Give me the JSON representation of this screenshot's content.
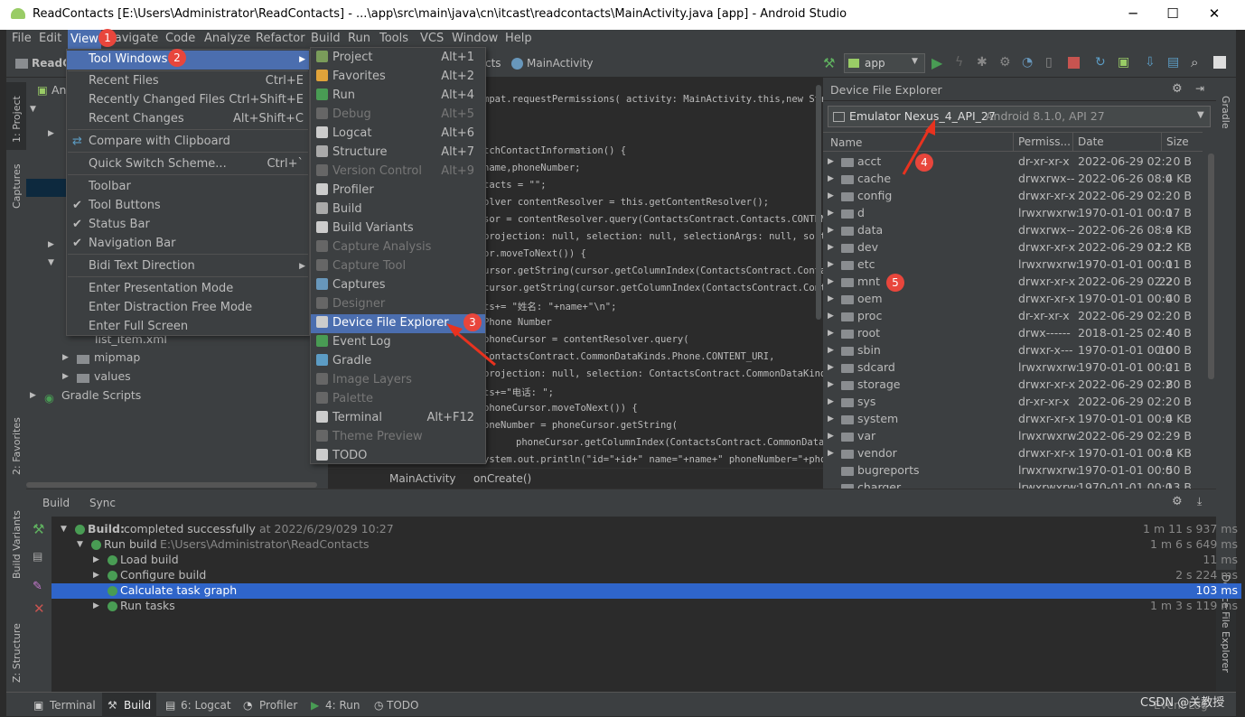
{
  "window": {
    "title": "ReadContacts [E:\\Users\\Administrator\\ReadContacts] - ...\\app\\src\\main\\java\\cn\\itcast\\readcontacts\\MainActivity.java [app] - Android Studio",
    "min": "─",
    "max": "☐",
    "close": "✕"
  },
  "menubar": [
    "File",
    "Edit",
    "View",
    "Navigate",
    "Code",
    "Analyze",
    "Refactor",
    "Build",
    "Run",
    "Tools",
    "VCS",
    "Window",
    "Help"
  ],
  "toolbar": {
    "project": "ReadC",
    "tab1": "cts",
    "tab2": "MainActivity",
    "config": "app"
  },
  "view_menu": [
    {
      "label": "Tool Windows",
      "shortcut": "",
      "arrow": "▶"
    },
    {
      "label": "Recent Files",
      "shortcut": "Ctrl+E"
    },
    {
      "label": "Recently Changed Files",
      "shortcut": "Ctrl+Shift+E"
    },
    {
      "label": "Recent Changes",
      "shortcut": "Alt+Shift+C"
    },
    {
      "label": "Compare with Clipboard",
      "shortcut": ""
    },
    {
      "label": "Quick Switch Scheme...",
      "shortcut": "Ctrl+`"
    },
    {
      "label": "Toolbar",
      "shortcut": ""
    },
    {
      "label": "Tool Buttons",
      "shortcut": "",
      "check": "✔"
    },
    {
      "label": "Status Bar",
      "shortcut": "",
      "check": "✔"
    },
    {
      "label": "Navigation Bar",
      "shortcut": "",
      "check": "✔"
    },
    {
      "label": "Bidi Text Direction",
      "shortcut": "",
      "arrow": "▶"
    },
    {
      "label": "Enter Presentation Mode",
      "shortcut": ""
    },
    {
      "label": "Enter Distraction Free Mode",
      "shortcut": ""
    },
    {
      "label": "Enter Full Screen",
      "shortcut": ""
    }
  ],
  "tool_windows": [
    {
      "label": "Project",
      "shortcut": "Alt+1",
      "color": "#7a9c5a"
    },
    {
      "label": "Favorites",
      "shortcut": "Alt+2",
      "color": "#e0a33a"
    },
    {
      "label": "Run",
      "shortcut": "Alt+4",
      "color": "#499c54"
    },
    {
      "label": "Debug",
      "shortcut": "Alt+5",
      "color": "#666"
    },
    {
      "label": "Logcat",
      "shortcut": "Alt+6",
      "color": "#ccc"
    },
    {
      "label": "Structure",
      "shortcut": "Alt+7",
      "color": "#aaa"
    },
    {
      "label": "Version Control",
      "shortcut": "Alt+9",
      "color": "#666"
    },
    {
      "label": "Profiler",
      "shortcut": "",
      "color": "#ccc"
    },
    {
      "label": "Build",
      "shortcut": "",
      "color": "#aaa"
    },
    {
      "label": "Build Variants",
      "shortcut": "",
      "color": "#ccc"
    },
    {
      "label": "Capture Analysis",
      "shortcut": "",
      "color": "#666"
    },
    {
      "label": "Capture Tool",
      "shortcut": "",
      "color": "#666"
    },
    {
      "label": "Captures",
      "shortcut": "",
      "color": "#6897bb"
    },
    {
      "label": "Designer",
      "shortcut": "",
      "color": "#666"
    },
    {
      "label": "Device File Explorer",
      "shortcut": "",
      "color": "#ccc"
    },
    {
      "label": "Event Log",
      "shortcut": "",
      "color": "#499c54"
    },
    {
      "label": "Gradle",
      "shortcut": "",
      "color": "#5c9cc4"
    },
    {
      "label": "Image Layers",
      "shortcut": "",
      "color": "#666"
    },
    {
      "label": "Palette",
      "shortcut": "",
      "color": "#666"
    },
    {
      "label": "Terminal",
      "shortcut": "Alt+F12",
      "color": "#ccc"
    },
    {
      "label": "Theme Preview",
      "shortcut": "",
      "color": "#666"
    },
    {
      "label": "TODO",
      "shortcut": "",
      "color": "#ccc"
    }
  ],
  "project_tree": [
    "An",
    "mipmap",
    "values",
    "Gradle Scripts",
    "list_item.xml"
  ],
  "editor_lines": [
    "mpat.requestPermissions( activity: MainActivity.this,new String",
    "tchContactInformation() {",
    "name,phoneNumber;",
    "tacts = \"\";",
    "olver contentResolver = this.getContentResolver();",
    "sor = contentResolver.query(ContactsContract.Contacts.CONTENT",
    "projection: null,  selection: null,  selectionArgs: null,  sortOrd",
    "or.moveToNext()) {",
    "ursor.getString(cursor.getColumnIndex(ContactsContract.Contac",
    " cursor.getString(cursor.getColumnIndex(ContactsContract.Cont",
    "ts+= \"姓名: \"+name+\"\\n\";",
    " Phone Number",
    " phoneCursor = contentResolver.query(",
    "ContactsContract.CommonDataKinds.Phone.CONTENT_URI,",
    " projection: null,  selection: ContactsContract.CommonDataKinds",
    "ts+=\"电话: \";",
    "phoneCursor.moveToNext()) {",
    "oneNumber = phoneCursor.getString(",
    "         phoneCursor.getColumnIndex(ContactsContract.CommonDataKin",
    "ystem.out.println(\"id=\"+id+\" name=\"+name+\" phoneNumber=\"+phoneNu"
  ],
  "breadcrumb": [
    "MainActivity",
    "onCreate()"
  ],
  "dfe": {
    "title": "Device File Explorer",
    "device": "Emulator Nexus_4_API_27",
    "device_detail": "Android 8.1.0, API 27",
    "columns": [
      "Name",
      "Permiss...",
      "Date",
      "Size"
    ],
    "rows": [
      [
        "acct",
        "dr-xr-xr-x",
        "2022-06-29 02:2",
        "0 B"
      ],
      [
        "cache",
        "drwxrwx--",
        "2022-06-26 08:0",
        "4 KB"
      ],
      [
        "config",
        "drwxr-xr-x",
        "2022-06-29 02:2",
        "0 B"
      ],
      [
        "d",
        "lrwxrwxrw:",
        "1970-01-01 00:0",
        "17 B"
      ],
      [
        "data",
        "drwxrwx--",
        "2022-06-26 08:0",
        "4 KB"
      ],
      [
        "dev",
        "drwxr-xr-x",
        "2022-06-29 02:2",
        "1.2 KB"
      ],
      [
        "etc",
        "lrwxrwxrw:",
        "1970-01-01 00:0",
        "11 B"
      ],
      [
        "mnt",
        "drwxr-xr-x",
        "2022-06-29 02:2",
        "220 B"
      ],
      [
        "oem",
        "drwxr-xr-x",
        "1970-01-01 00:0",
        "40 B"
      ],
      [
        "proc",
        "dr-xr-xr-x",
        "2022-06-29 02:2",
        "0 B"
      ],
      [
        "root",
        "drwx------",
        "2018-01-25 02:4",
        "40 B"
      ],
      [
        "sbin",
        "drwxr-x---",
        "1970-01-01 00:0",
        "100 B"
      ],
      [
        "sdcard",
        "lrwxrwxrw:",
        "1970-01-01 00:0",
        "21 B"
      ],
      [
        "storage",
        "drwxr-xr-x",
        "2022-06-29 02:2",
        "80 B"
      ],
      [
        "sys",
        "dr-xr-xr-x",
        "2022-06-29 02:2",
        "0 B"
      ],
      [
        "system",
        "drwxr-xr-x",
        "1970-01-01 00:0",
        "4 KB"
      ],
      [
        "var",
        "lrwxrwxrw:",
        "2022-06-29 02:2",
        "9 B"
      ],
      [
        "vendor",
        "drwxr-xr-x",
        "1970-01-01 00:0",
        "4 KB"
      ],
      [
        "bugreports",
        "lrwxrwxrw:",
        "1970-01-01 00:0",
        "50 B"
      ],
      [
        "charger",
        "lrwxrwxrw:",
        "1970-01-01 00:0",
        "13 B"
      ]
    ]
  },
  "build": {
    "tabs": [
      "Build",
      "Sync"
    ],
    "rows": [
      {
        "label": "Build:",
        "rest": "completed successfully",
        "extra": "at 2022/6/29/029 10:27",
        "time": "1 m 11 s 937 ms"
      },
      {
        "label": "Run build",
        "rest": "",
        "extra": "E:\\Users\\Administrator\\ReadContacts",
        "time": "1 m 6 s 649 ms"
      },
      {
        "label": "Load build",
        "rest": "",
        "extra": "",
        "time": "11 ms"
      },
      {
        "label": "Configure build",
        "rest": "",
        "extra": "",
        "time": "2 s 224 ms"
      },
      {
        "label": "Calculate task graph",
        "rest": "",
        "extra": "",
        "time": "103 ms"
      },
      {
        "label": "Run tasks",
        "rest": "",
        "extra": "",
        "time": "1 m 3 s 119 ms"
      }
    ]
  },
  "left_strip": [
    "1: Project",
    "Captures",
    "2: Favorites",
    "Build Variants",
    "Z: Structure"
  ],
  "right_strip": [
    "Gradle",
    "Device File Explorer"
  ],
  "status": {
    "items": [
      "Terminal",
      "Build",
      "6: Logcat",
      "Profiler",
      "4: Run",
      "TODO"
    ],
    "event_log": "Event Log",
    "watermark": "CSDN @关教授"
  },
  "badges": [
    "1",
    "2",
    "3",
    "4",
    "5"
  ]
}
